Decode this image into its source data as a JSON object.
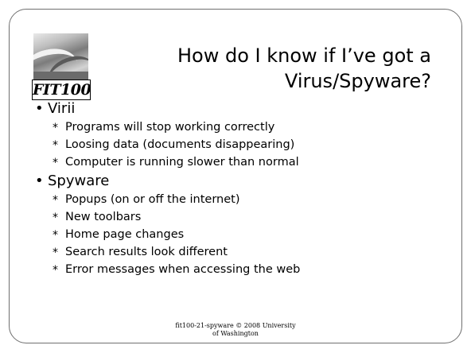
{
  "logo": {
    "caption": "FIT100"
  },
  "title": {
    "line1": "How do I know if I’ve got a",
    "line2": "Virus/Spyware?"
  },
  "sections": [
    {
      "heading": "Virii",
      "items": [
        "Programs will stop working correctly",
        "Loosing data (documents disappearing)",
        "Computer is running slower than normal"
      ]
    },
    {
      "heading": "Spyware",
      "items": [
        "Popups (on or off the internet)",
        "New toolbars",
        "Home page changes",
        "Search results look different",
        "Error messages when accessing the web"
      ]
    }
  ],
  "footer": {
    "line1": "fit100-21-spyware © 2008 University",
    "line2": "of Washington"
  }
}
